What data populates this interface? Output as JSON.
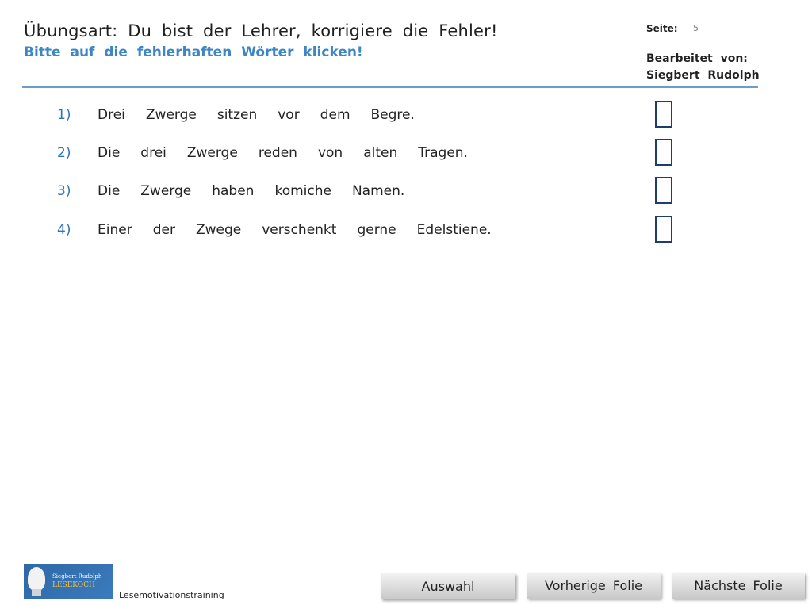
{
  "header": {
    "title": "Übungsart: Du bist der Lehrer, korrigiere die Fehler!",
    "subtitle": "Bitte auf die fehlerhaften Wörter klicken!"
  },
  "meta": {
    "page_label": "Seite:",
    "page_number": "5",
    "editor_label": "Bearbeitet von:",
    "editor_name": "Siegbert Rudolph"
  },
  "exercises": [
    {
      "number": "1)",
      "words": [
        "Drei",
        "Zwerge",
        "sitzen",
        "vor",
        "dem",
        "Begre."
      ]
    },
    {
      "number": "2)",
      "words": [
        "Die",
        "drei",
        "Zwerge",
        "reden",
        "von",
        "alten",
        "Tragen."
      ]
    },
    {
      "number": "3)",
      "words": [
        "Die",
        "Zwerge",
        "haben",
        "komiche",
        "Namen."
      ]
    },
    {
      "number": "4)",
      "words": [
        "Einer",
        "der",
        "Zwege",
        "verschenkt",
        "gerne",
        "Edelstiene."
      ]
    }
  ],
  "footer": {
    "logo_line1": "Siegbert Rudolph",
    "logo_line2": "LESEKOCH",
    "label": "Lesemotivationstraining",
    "btn_selection": "Auswahl",
    "btn_previous": "Vorherige Folie",
    "btn_next": "Nächste Folie"
  },
  "colors": {
    "accent_blue": "#3c86c5",
    "number_blue": "#2f74b5",
    "checkbox_border": "#1f3d6b"
  }
}
